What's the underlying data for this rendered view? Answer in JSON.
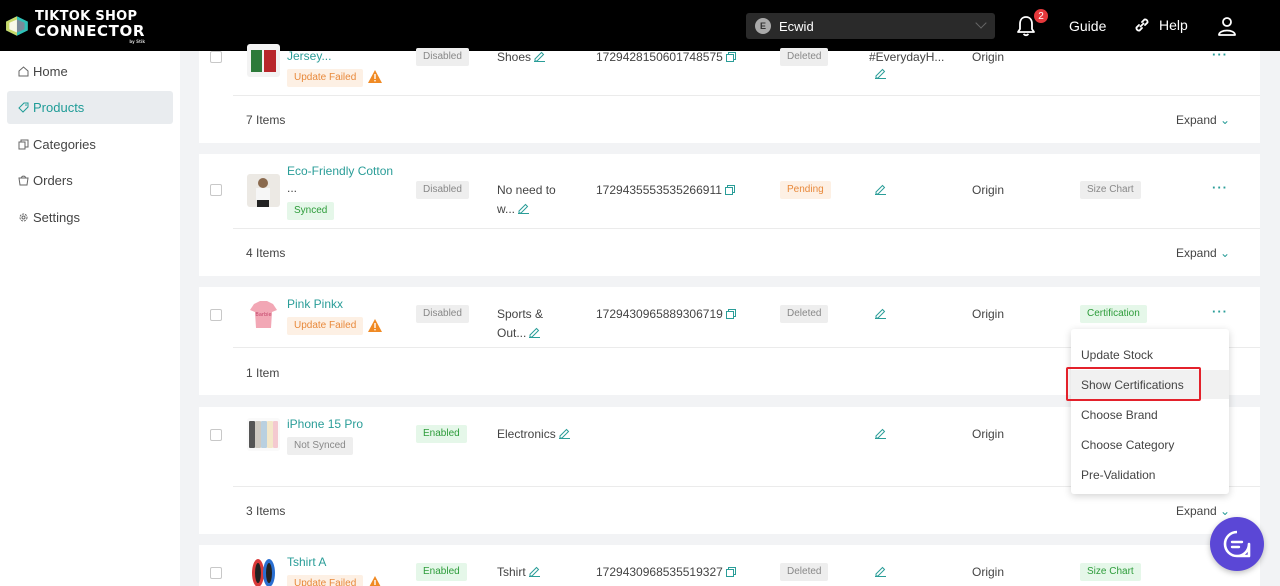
{
  "header": {
    "logo_line1": "TIKTOK SHOP",
    "logo_line2": "CONNECTOR",
    "logo_line3": "by Stik",
    "store_initial": "E",
    "store_name": "Ecwid",
    "notification_count": "2",
    "guide_label": "Guide",
    "help_label": "Help"
  },
  "sidebar": {
    "items": [
      {
        "label": "Home",
        "icon": "home-icon",
        "active": false
      },
      {
        "label": "Products",
        "icon": "tag-icon",
        "active": true
      },
      {
        "label": "Categories",
        "icon": "categories-icon",
        "active": false
      },
      {
        "label": "Orders",
        "icon": "orders-icon",
        "active": false
      },
      {
        "label": "Settings",
        "icon": "gear-icon",
        "active": false
      }
    ]
  },
  "products": [
    {
      "name": "Jersey...",
      "sync_status": "Update Failed",
      "status": "Disabled",
      "category": "Shoes",
      "product_id": "1729428150601748575",
      "tiktok_status": "Deleted",
      "tag_text": "#EverydayH...",
      "origin": "Origin",
      "items_count": "7 Items",
      "expand_label": "Expand"
    },
    {
      "name_line1": "Eco-Friendly Cotton",
      "name_line2": "...",
      "sync_status": "Synced",
      "status": "Disabled",
      "category_line1": "No need to",
      "category_line2": "w...",
      "product_id": "1729435553535266911",
      "tiktok_status": "Pending",
      "origin": "Origin",
      "extra_tag": "Size Chart",
      "items_count": "4 Items",
      "expand_label": "Expand"
    },
    {
      "name": "Pink Pinkx",
      "sync_status": "Update Failed",
      "status": "Disabled",
      "category_line1": "Sports &",
      "category_line2": "Out...",
      "product_id": "1729430965889306719",
      "tiktok_status": "Deleted",
      "origin": "Origin",
      "extra_tag": "Certification",
      "items_count": "1 Item"
    },
    {
      "name": "iPhone 15 Pro",
      "sync_status": "Not Synced",
      "status": "Enabled",
      "category": "Electronics",
      "origin": "Origin",
      "items_count": "3 Items",
      "expand_label": "Expand"
    },
    {
      "name": "Tshirt A",
      "sync_status": "Update Failed",
      "status": "Enabled",
      "category": "Tshirt",
      "product_id": "1729430968535519327",
      "tiktok_status": "Deleted",
      "origin": "Origin",
      "extra_tag": "Size Chart"
    }
  ],
  "action_menu": {
    "items": [
      "Update Stock",
      "Show Certifications",
      "Choose Brand",
      "Choose Category",
      "Pre-Validation"
    ],
    "highlighted": "Show Certifications"
  },
  "more_label": "···",
  "colors": {
    "accent": "#2a9d98",
    "chat": "#5b47d6",
    "highlight_box": "#e3212b"
  }
}
